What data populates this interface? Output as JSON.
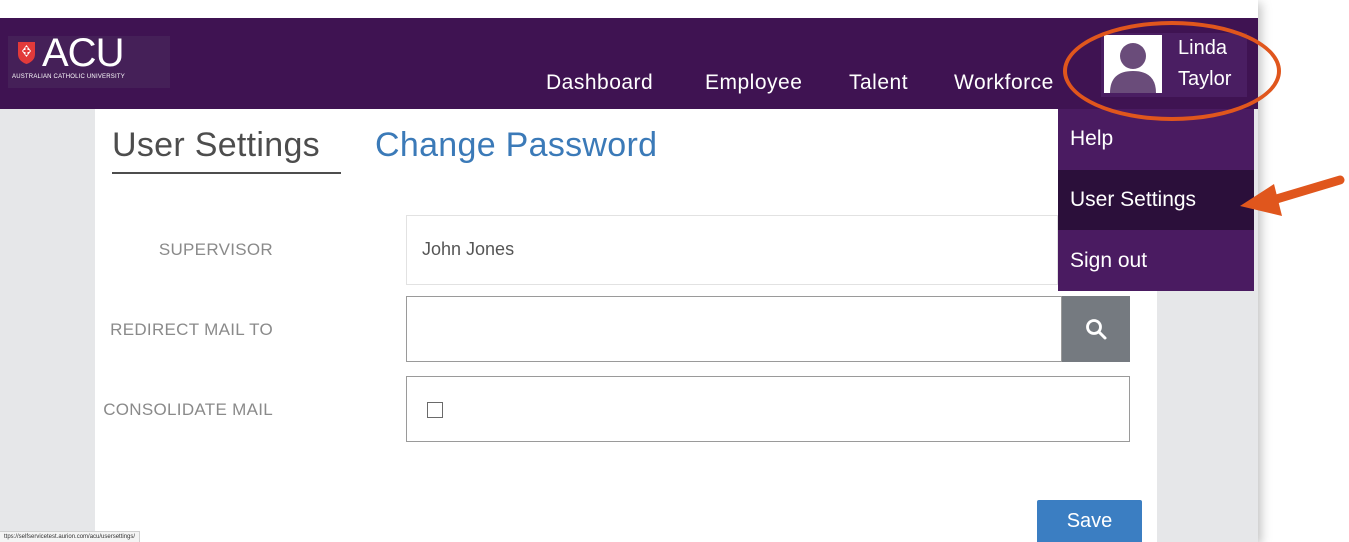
{
  "header": {
    "logo_text": "ACU",
    "logo_subtitle": "AUSTRALIAN CATHOLIC UNIVERSITY",
    "nav": [
      "Dashboard",
      "Employee",
      "Talent",
      "Workforce"
    ],
    "user_first": "Linda",
    "user_last": "Taylor"
  },
  "user_menu": {
    "items": [
      "Help",
      "User Settings",
      "Sign out"
    ],
    "active": "User Settings"
  },
  "tabs": {
    "active": "User Settings",
    "link": "Change Password"
  },
  "form": {
    "supervisor_label": "SUPERVISOR",
    "supervisor_value": "John Jones",
    "redirect_label": "REDIRECT MAIL TO",
    "redirect_value": "",
    "consolidate_label": "CONSOLIDATE MAIL",
    "consolidate_checked": false,
    "save_label": "Save"
  },
  "status_bar": {
    "url": "ttps://selfservicetest.aurion.com/acu/usersettings/"
  },
  "colors": {
    "brand_purple": "#3f1352",
    "menu_purple": "#4a1b61",
    "menu_active": "#2b0f3a",
    "link_blue": "#3b7ab8",
    "button_blue": "#3b7ec2",
    "annotation_orange": "#e0561d"
  },
  "icons": {
    "logo": "acu-shield-icon",
    "avatar": "user-avatar-icon",
    "search": "search-icon",
    "annotation_arrow": "arrow-left-icon"
  }
}
